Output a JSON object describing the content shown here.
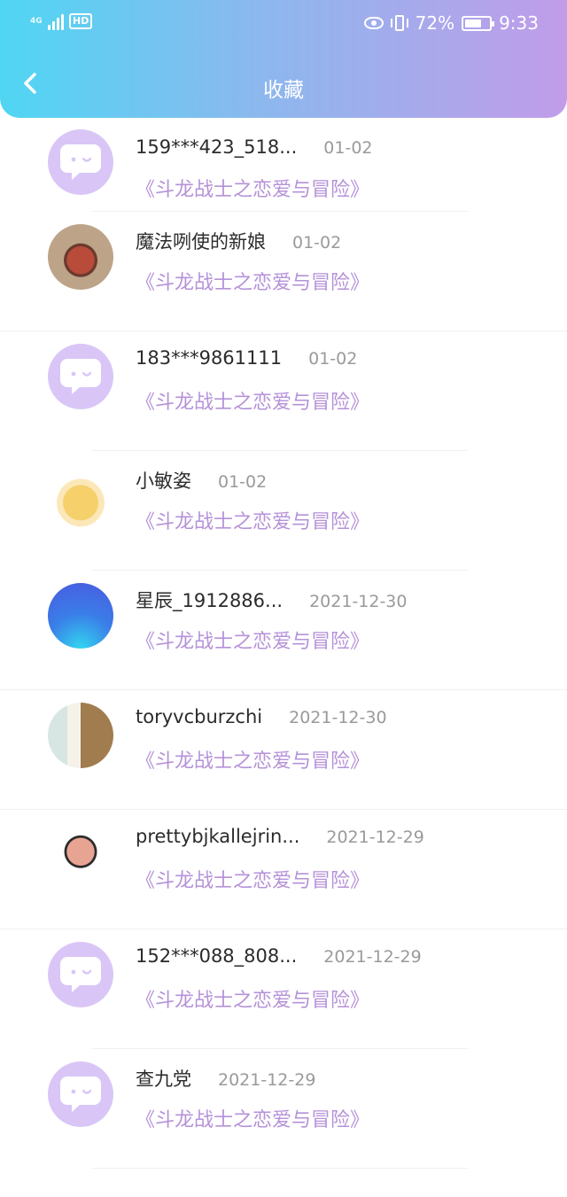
{
  "status_bar": {
    "network": "4G",
    "hd": "HD",
    "battery": "72%",
    "battery_level": 0.72,
    "time": "9:33"
  },
  "header": {
    "title": "收藏",
    "back_icon": "chevron-left-icon"
  },
  "favorites": [
    {
      "username": "159***423_518...",
      "date": "01-02",
      "book": "《斗龙战士之恋爱与冒险》",
      "avatar": "default-chat-avatar"
    },
    {
      "username": "魔法咧使的新娘",
      "date": "01-02",
      "book": "《斗龙战士之恋爱与冒险》",
      "avatar": "red-sneakers-photo"
    },
    {
      "username": "183***9861111",
      "date": "01-02",
      "book": "《斗龙战士之恋爱与冒险》",
      "avatar": "default-chat-avatar"
    },
    {
      "username": "小敏姿",
      "date": "01-02",
      "book": "《斗龙战士之恋爱与冒险》",
      "avatar": "pikachu-photo"
    },
    {
      "username": "星辰_1912886...",
      "date": "2021-12-30",
      "book": "《斗龙战士之恋爱与冒险》",
      "avatar": "starry-sky-photo"
    },
    {
      "username": "toryvcburzchi",
      "date": "2021-12-30",
      "book": "《斗龙战士之恋爱与冒险》",
      "avatar": "building-photo"
    },
    {
      "username": "prettybjkallejrin...",
      "date": "2021-12-29",
      "book": "《斗龙战士之恋爱与冒险》",
      "avatar": "sticker-image"
    },
    {
      "username": "152***088_808...",
      "date": "2021-12-29",
      "book": "《斗龙战士之恋爱与冒险》",
      "avatar": "default-chat-avatar"
    },
    {
      "username": "查九党",
      "date": "2021-12-29",
      "book": "《斗龙战士之恋爱与冒险》",
      "avatar": "default-chat-avatar"
    }
  ],
  "colors": {
    "header_gradient_start": "#4fd6f3",
    "header_gradient_end": "#c19ce9",
    "book_title": "#b592d8",
    "default_avatar_bg": "#d9c6f7"
  }
}
